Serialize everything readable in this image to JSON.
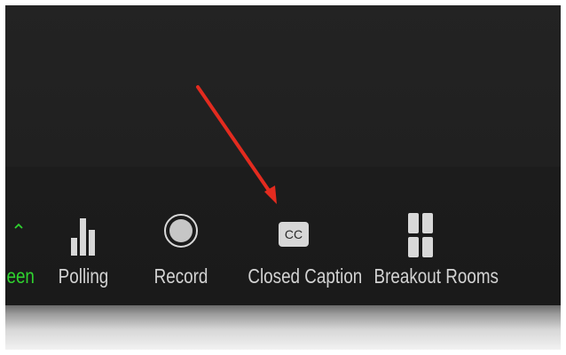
{
  "toolbar": {
    "share_screen_partial_label": "een",
    "polling_label": "Polling",
    "record_label": "Record",
    "closed_caption_label": "Closed Caption",
    "cc_icon_text": "CC",
    "breakout_rooms_label": "Breakout Rooms"
  },
  "icons": {
    "share_screen": "chevron-up-icon",
    "polling": "poll-bars-icon",
    "record": "record-circle-icon",
    "closed_caption": "cc-icon",
    "breakout_rooms": "breakout-grid-icon"
  },
  "colors": {
    "background": "#232323",
    "toolbar": "#1c1c1c",
    "label": "#d2d2d2",
    "share_screen_accent": "#2fd22f",
    "annotation_arrow": "#e32b1f"
  }
}
